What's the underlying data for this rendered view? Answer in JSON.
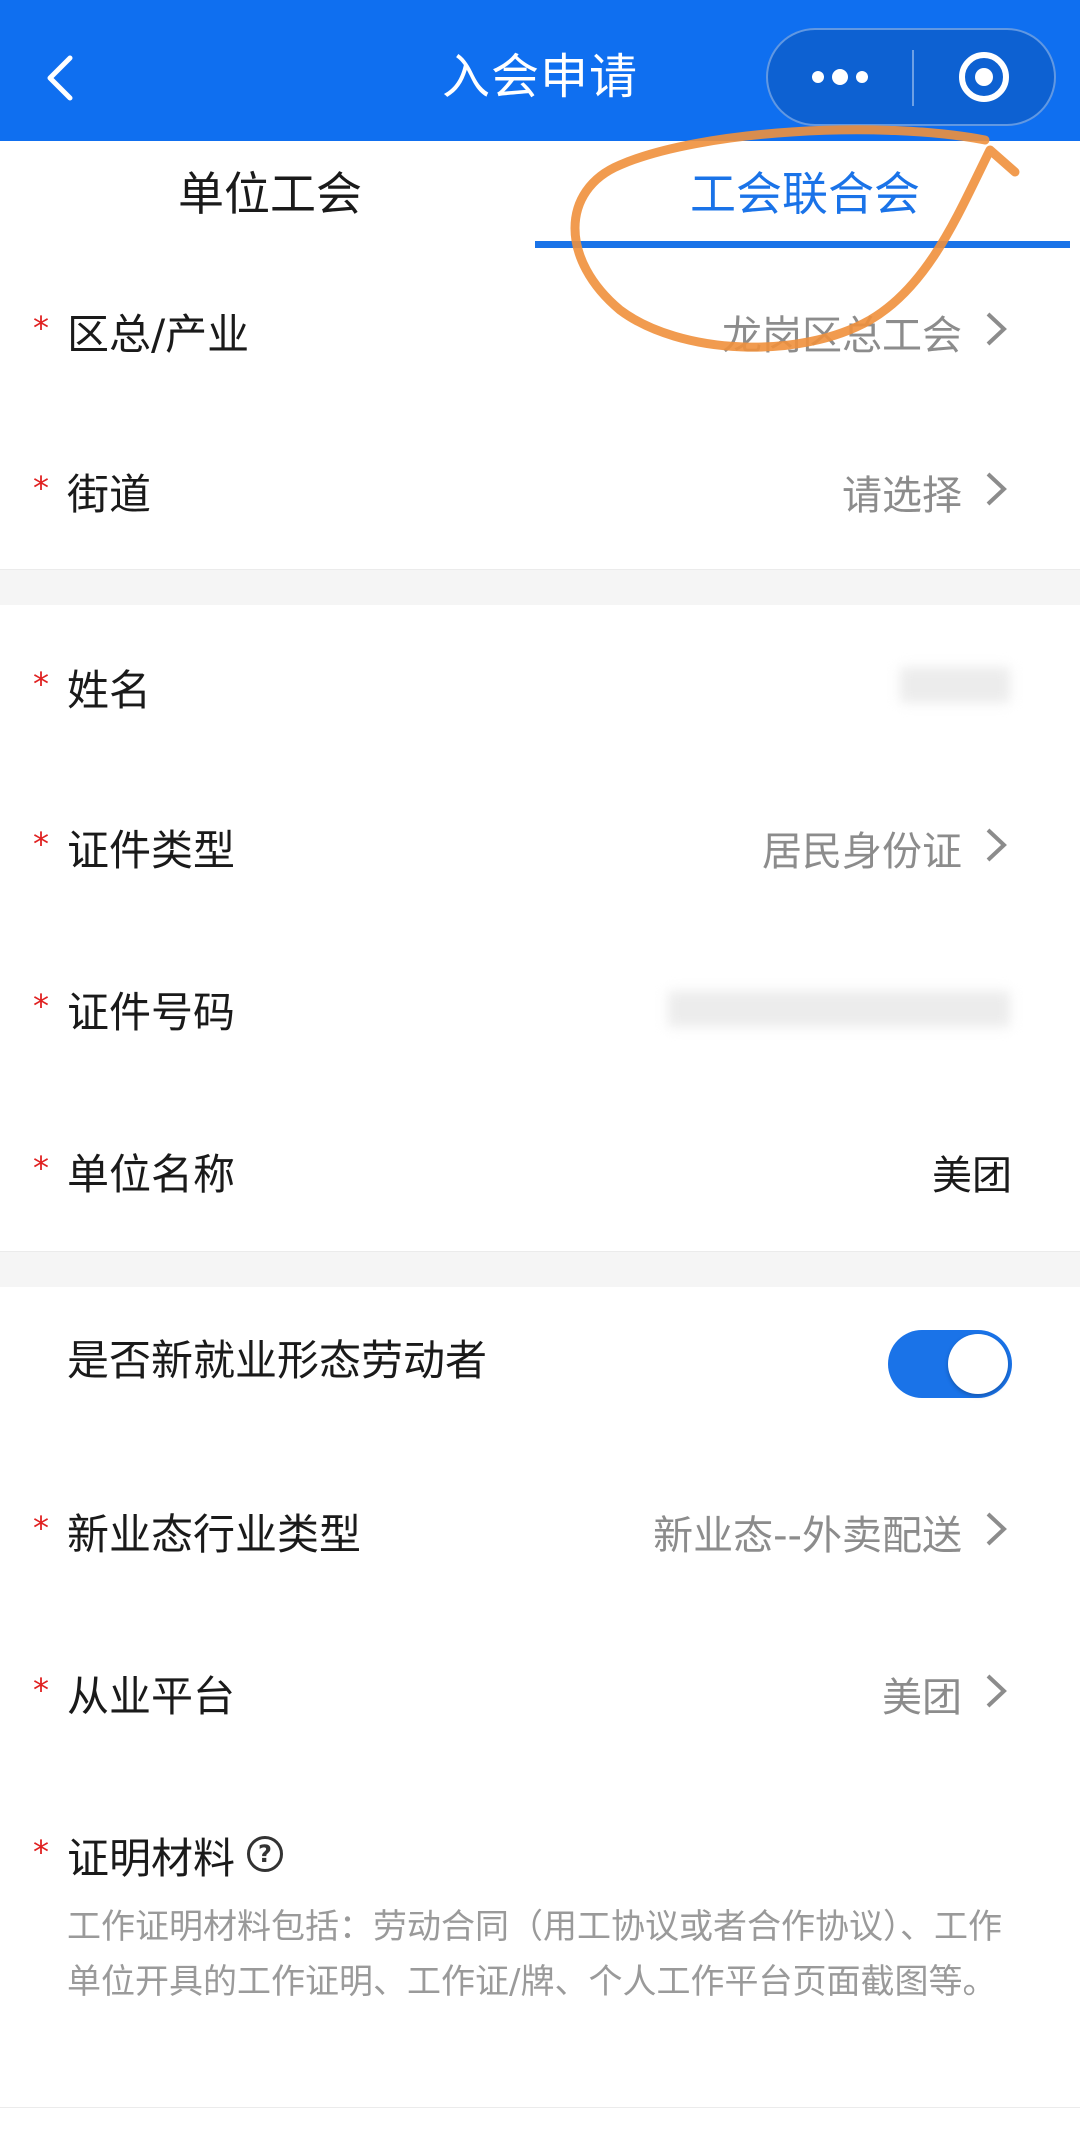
{
  "nav": {
    "title": "入会申请"
  },
  "tabs": [
    {
      "label": "单位工会",
      "active": false
    },
    {
      "label": "工会联合会",
      "active": true
    }
  ],
  "form": {
    "required_mark": "*",
    "district": {
      "label": "区总/产业",
      "value": "龙岗区总工会"
    },
    "street": {
      "label": "街道",
      "value": "请选择"
    },
    "name": {
      "label": "姓名",
      "value": ""
    },
    "id_type": {
      "label": "证件类型",
      "value": "居民身份证"
    },
    "id_number": {
      "label": "证件号码",
      "value": ""
    },
    "company": {
      "label": "单位名称",
      "value": "美团"
    },
    "new_employment": {
      "label": "是否新就业形态劳动者",
      "checked": true
    },
    "industry_type": {
      "label": "新业态行业类型",
      "value": "新业态--外卖配送"
    },
    "platform": {
      "label": "从业平台",
      "value": "美团"
    },
    "proof": {
      "label": "证明材料",
      "help_icon": "?",
      "description": "工作证明材料包括：劳动合同（用工协议或者合作协议）、工作单位开具的工作证明、工作证/牌、个人工作平台页面截图等。"
    }
  },
  "colors": {
    "nav": "#0f6ff0",
    "accent": "#1a73e8",
    "required": "#e02020",
    "annotation": "#f0903c"
  },
  "icons": [
    "back-arrow-icon",
    "more-dots-icon",
    "close-target-icon",
    "chevron-right-icon",
    "help-circle-icon"
  ]
}
